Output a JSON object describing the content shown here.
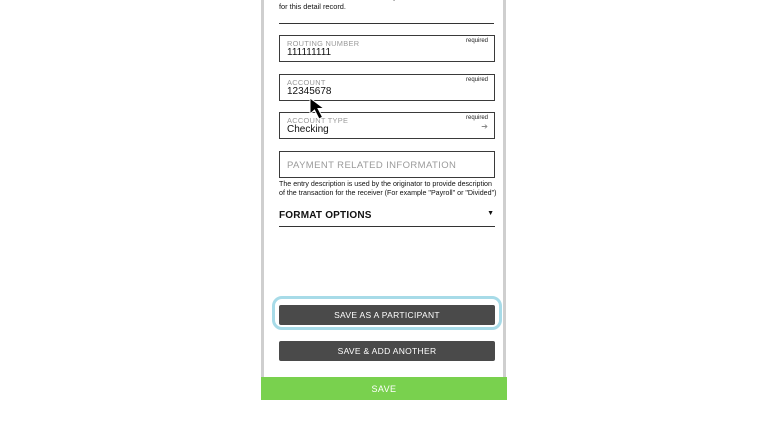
{
  "form": {
    "intro_text": "financial institution to ensure validity of the account information for this detail record.",
    "routing": {
      "label": "ROUTING NUMBER",
      "value": "111111111",
      "required": "required"
    },
    "account": {
      "label": "ACCOUNT",
      "value": "12345678",
      "required": "required"
    },
    "account_type": {
      "label": "ACCOUNT TYPE",
      "value": "Checking",
      "required": "required",
      "icon": "arrow-right-icon"
    },
    "payment_info": {
      "label": "PAYMENT RELATED INFORMATION",
      "value": ""
    },
    "payment_description": "The entry description is used by the originator to provide description of the transaction for the receiver (For example \"Payroll\" or \"Divided\")",
    "format_options": {
      "label": "FORMAT OPTIONS",
      "icon": "caret-down-icon"
    }
  },
  "buttons": {
    "save_participant": "SAVE AS A PARTICIPANT",
    "save_add_another": "SAVE & ADD ANOTHER",
    "save": "SAVE"
  },
  "colors": {
    "save_bar": "#79d14e",
    "button_dark": "#4a4a4a",
    "focus_ring": "#a7dbe8"
  }
}
